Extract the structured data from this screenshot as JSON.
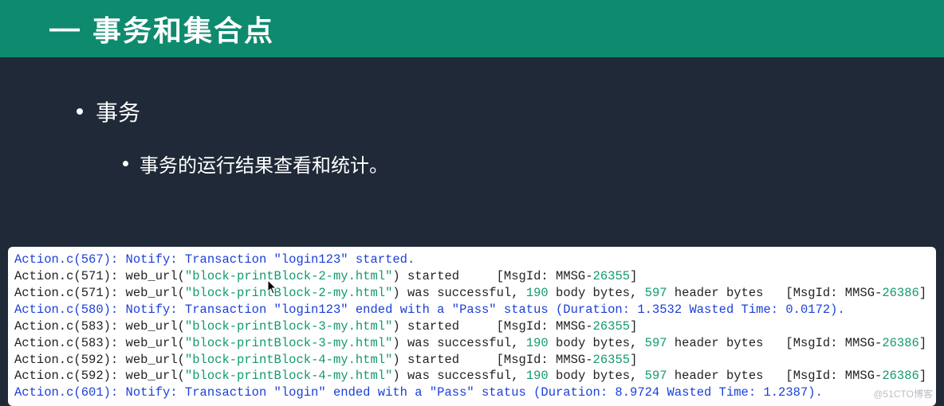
{
  "banner": {
    "dash": "—",
    "title": "事务和集合点"
  },
  "content": {
    "l1": "事务",
    "l2": "事务的运行结果查看和统计。"
  },
  "log": {
    "lines": [
      {
        "style": "blue",
        "plain": "Action.c(567): Notify: Transaction \"login123\" started."
      },
      {
        "style": "norm",
        "pre": "Action.c(571): web_url(",
        "str": "\"block-printBlock-2-my.html\"",
        "mid": ") started     [MsgId: MMSG-",
        "num": "26355",
        "post": "]"
      },
      {
        "style": "norm",
        "pre": "Action.c(571): web_url(",
        "str": "\"block-printBlock-2-my.html\"",
        "mid": ") was successful, ",
        "n1": "190",
        "mid2": " body bytes, ",
        "n2": "597",
        "mid3": " header bytes   [MsgId: MMSG-",
        "num": "26386",
        "post": "]"
      },
      {
        "style": "blue",
        "plain": "Action.c(580): Notify: Transaction \"login123\" ended with a \"Pass\" status (Duration: 1.3532 Wasted Time: 0.0172)."
      },
      {
        "style": "norm",
        "pre": "Action.c(583): web_url(",
        "str": "\"block-printBlock-3-my.html\"",
        "mid": ") started     [MsgId: MMSG-",
        "num": "26355",
        "post": "]"
      },
      {
        "style": "norm",
        "pre": "Action.c(583): web_url(",
        "str": "\"block-printBlock-3-my.html\"",
        "mid": ") was successful, ",
        "n1": "190",
        "mid2": " body bytes, ",
        "n2": "597",
        "mid3": " header bytes   [MsgId: MMSG-",
        "num": "26386",
        "post": "]"
      },
      {
        "style": "norm",
        "pre": "Action.c(592): web_url(",
        "str": "\"block-printBlock-4-my.html\"",
        "mid": ") started     [MsgId: MMSG-",
        "num": "26355",
        "post": "]"
      },
      {
        "style": "norm",
        "pre": "Action.c(592): web_url(",
        "str": "\"block-printBlock-4-my.html\"",
        "mid": ") was successful, ",
        "n1": "190",
        "mid2": " body bytes, ",
        "n2": "597",
        "mid3": " header bytes   [MsgId: MMSG-",
        "num": "26386",
        "post": "]"
      },
      {
        "style": "blue",
        "plain": "Action.c(601): Notify: Transaction \"login\" ended with a \"Pass\" status (Duration: 8.9724 Wasted Time: 1.2387)."
      }
    ]
  },
  "watermark": "@51CTO博客"
}
